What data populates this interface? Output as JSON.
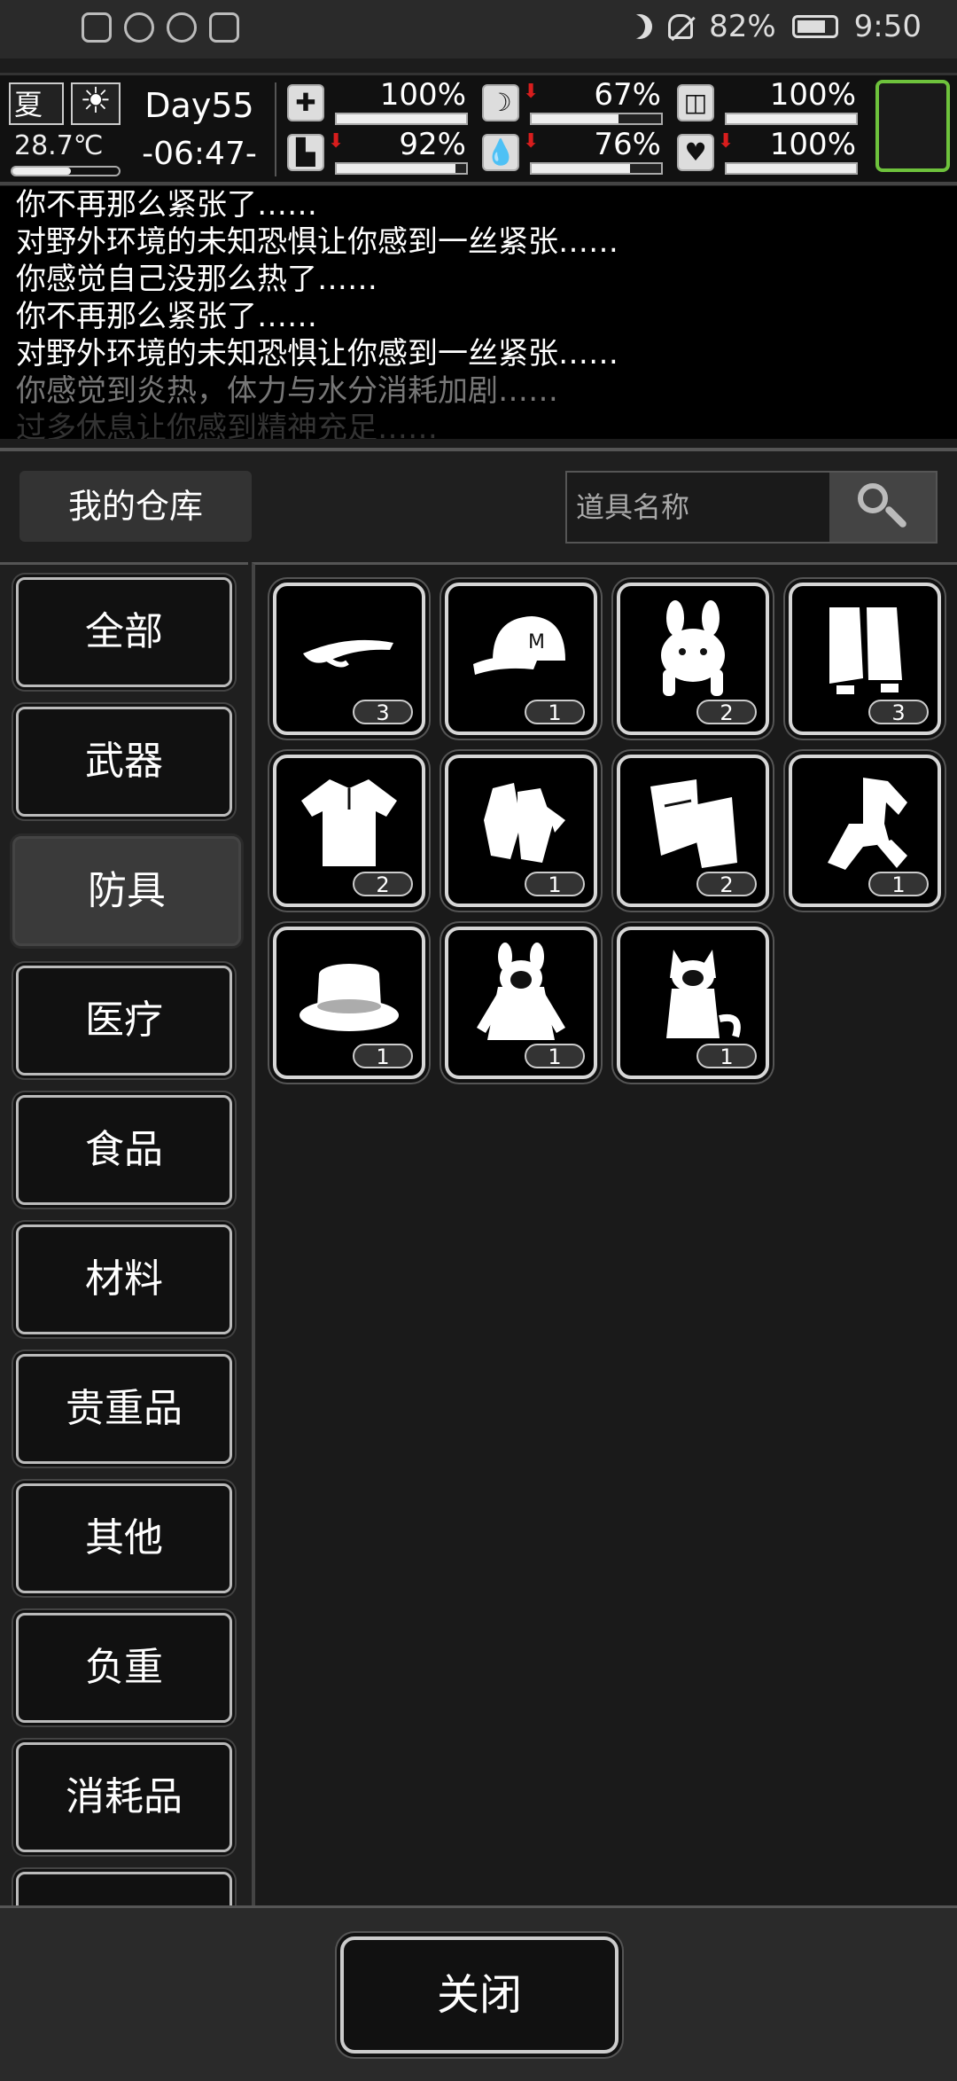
{
  "status_bar": {
    "battery": "82%",
    "battery_level": 0.82,
    "time": "9:50",
    "icons": [
      "alert-icon",
      "wifi-icon",
      "alarm-icon",
      "calendar-icon",
      "moon-icon",
      "bell-off-icon",
      "battery-icon"
    ]
  },
  "hud": {
    "season": "夏",
    "temperature": "28.7℃",
    "temperature_level": 0.55,
    "day": "Day55",
    "clock": "-06:47-",
    "stats": [
      {
        "icon": "medkit-icon",
        "glyph": "✚",
        "value": "100%",
        "level": 1.0,
        "down": false
      },
      {
        "icon": "stomach-icon",
        "glyph": "☽",
        "value": "67%",
        "level": 0.67,
        "down": true
      },
      {
        "icon": "pill-icon",
        "glyph": "◫",
        "value": "100%",
        "level": 1.0,
        "down": false
      },
      {
        "icon": "boot-icon",
        "glyph": "▙",
        "value": "92%",
        "level": 0.92,
        "down": true
      },
      {
        "icon": "water-drop-icon",
        "glyph": "💧",
        "value": "76%",
        "level": 0.76,
        "down": true
      },
      {
        "icon": "heart-icon",
        "glyph": "♥",
        "value": "100%",
        "level": 1.0,
        "down": true
      }
    ]
  },
  "log": {
    "lines": [
      "你不再那么紧张了……",
      "对野外环境的未知恐惧让你感到一丝紧张……",
      "你感觉自己没那么热了……",
      "你不再那么紧张了……",
      "对野外环境的未知恐惧让你感到一丝紧张……",
      "你感觉到炎热，体力与水分消耗加剧……",
      "过多休息让你感到精神充足……"
    ]
  },
  "warehouse": {
    "title": "我的仓库",
    "search_placeholder": "道具名称",
    "categories": [
      "全部",
      "武器",
      "防具",
      "医疗",
      "食品",
      "材料",
      "贵重品",
      "其他",
      "负重",
      "消耗品"
    ],
    "active_category": "防具",
    "items": [
      {
        "icon": "visor-icon",
        "count": "3"
      },
      {
        "icon": "baseball-cap-icon",
        "count": "1"
      },
      {
        "icon": "bunny-hood-icon",
        "count": "2"
      },
      {
        "icon": "vest-icon",
        "count": "3"
      },
      {
        "icon": "polo-shirt-icon",
        "count": "2"
      },
      {
        "icon": "gloves-icon",
        "count": "1"
      },
      {
        "icon": "fingerless-gloves-icon",
        "count": "2"
      },
      {
        "icon": "tracksuit-icon",
        "count": "1"
      },
      {
        "icon": "bucket-hat-icon",
        "count": "1"
      },
      {
        "icon": "bunny-coat-icon",
        "count": "1"
      },
      {
        "icon": "cat-costume-icon",
        "count": "1"
      }
    ],
    "close_label": "关闭"
  }
}
